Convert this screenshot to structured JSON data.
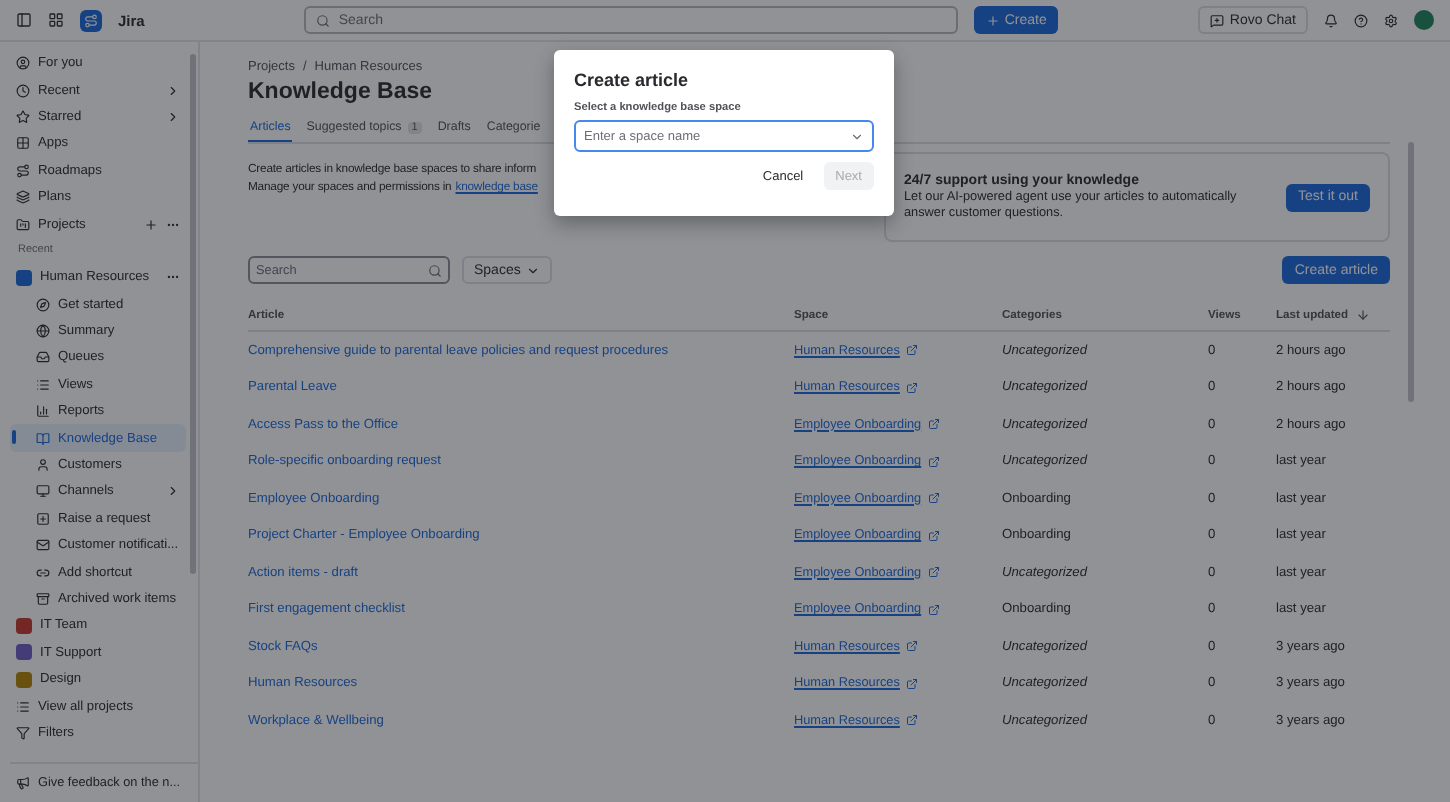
{
  "topbar": {
    "app_name": "Jira",
    "search": {
      "placeholder": "Search"
    },
    "create_button": "Create",
    "rovo_button": "Rovo Chat"
  },
  "sidebar": {
    "items": [
      {
        "label": "For you",
        "chevron": false,
        "more": false
      },
      {
        "label": "Recent",
        "chevron": true,
        "more": false
      },
      {
        "label": "Starred",
        "chevron": true,
        "more": false
      },
      {
        "label": "Apps",
        "chevron": false,
        "more": false
      },
      {
        "label": "Roadmaps",
        "chevron": false,
        "more": false
      },
      {
        "label": "Plans",
        "chevron": false,
        "more": false
      },
      {
        "label": "Projects",
        "chevron": false,
        "more": true
      }
    ],
    "section_label": "Recent",
    "projects": [
      {
        "label": "Human Resources",
        "more": true,
        "children": [
          {
            "label": "Get started",
            "selected": false,
            "chevron": false
          },
          {
            "label": "Summary",
            "selected": false,
            "chevron": false
          },
          {
            "label": "Queues",
            "selected": false,
            "chevron": false
          },
          {
            "label": "Views",
            "selected": false,
            "chevron": false
          },
          {
            "label": "Reports",
            "selected": false,
            "chevron": false
          },
          {
            "label": "Knowledge Base",
            "selected": true,
            "chevron": false
          },
          {
            "label": "Customers",
            "selected": false,
            "chevron": false
          },
          {
            "label": "Channels",
            "selected": false,
            "chevron": true
          },
          {
            "label": "Raise a request",
            "selected": false,
            "chevron": false
          },
          {
            "label": "Customer notificati...",
            "selected": false,
            "chevron": false
          },
          {
            "label": "Add shortcut",
            "selected": false,
            "chevron": false
          },
          {
            "label": "Archived work items",
            "selected": false,
            "chevron": false
          }
        ]
      },
      {
        "label": "IT Team",
        "more": false
      },
      {
        "label": "IT Support",
        "more": false
      },
      {
        "label": "Design",
        "more": false
      }
    ],
    "view_all": "View all projects",
    "filters": "Filters",
    "feedback": "Give feedback on the n..."
  },
  "breadcrumbs": [
    "Projects",
    "Human Resources"
  ],
  "breadcrumb_separator": "/",
  "page_title": "Knowledge Base",
  "tabs": [
    {
      "label": "Articles",
      "selected": true
    },
    {
      "label": "Suggested topics",
      "selected": false,
      "count": "1"
    },
    {
      "label": "Drafts",
      "selected": false
    },
    {
      "label": "Categorie",
      "selected": false
    }
  ],
  "intro": {
    "line1": "Create articles in knowledge base spaces to share inform",
    "line2": "Manage your spaces and permissions in",
    "link": "knowledge base"
  },
  "promo": {
    "title": "24/7 support using your knowledge",
    "text": "Let our AI-powered agent use your articles to automatically answer customer questions.",
    "button": "Test it out"
  },
  "toolbar": {
    "search_placeholder": "Search",
    "spaces_button": "Spaces",
    "create_button": "Create article"
  },
  "table": {
    "columns": [
      "Article",
      "Space",
      "Categories",
      "Views",
      "Last updated"
    ],
    "rows": [
      {
        "article": "Comprehensive guide to parental leave policies and request procedures",
        "space": "Human Resources",
        "category": "Uncategorized",
        "uncategorized": true,
        "views": "0",
        "updated": "2 hours ago"
      },
      {
        "article": "Parental Leave",
        "space": "Human Resources",
        "category": "Uncategorized",
        "uncategorized": true,
        "views": "0",
        "updated": "2 hours ago"
      },
      {
        "article": "Access Pass to the Office",
        "space": "Employee Onboarding",
        "category": "Uncategorized",
        "uncategorized": true,
        "views": "0",
        "updated": "2 hours ago"
      },
      {
        "article": "Role-specific onboarding request",
        "space": "Employee Onboarding",
        "category": "Uncategorized",
        "uncategorized": true,
        "views": "0",
        "updated": "last year"
      },
      {
        "article": "Employee Onboarding",
        "space": "Employee Onboarding",
        "category": "Onboarding",
        "uncategorized": false,
        "views": "0",
        "updated": "last year"
      },
      {
        "article": "Project Charter - Employee Onboarding",
        "space": "Employee Onboarding",
        "category": "Onboarding",
        "uncategorized": false,
        "views": "0",
        "updated": "last year"
      },
      {
        "article": "Action items - draft",
        "space": "Employee Onboarding",
        "category": "Uncategorized",
        "uncategorized": true,
        "views": "0",
        "updated": "last year"
      },
      {
        "article": "First engagement checklist",
        "space": "Employee Onboarding",
        "category": "Onboarding",
        "uncategorized": false,
        "views": "0",
        "updated": "last year"
      },
      {
        "article": "Stock FAQs",
        "space": "Human Resources",
        "category": "Uncategorized",
        "uncategorized": true,
        "views": "0",
        "updated": "3 years ago"
      },
      {
        "article": "Human Resources",
        "space": "Human Resources",
        "category": "Uncategorized",
        "uncategorized": true,
        "views": "0",
        "updated": "3 years ago"
      },
      {
        "article": "Workplace & Wellbeing",
        "space": "Human Resources",
        "category": "Uncategorized",
        "uncategorized": true,
        "views": "0",
        "updated": "3 years ago"
      }
    ]
  },
  "modal": {
    "title": "Create article",
    "field_label": "Select a knowledge base space",
    "placeholder": "Enter a space name",
    "cancel": "Cancel",
    "next": "Next",
    "next_disabled": true
  }
}
